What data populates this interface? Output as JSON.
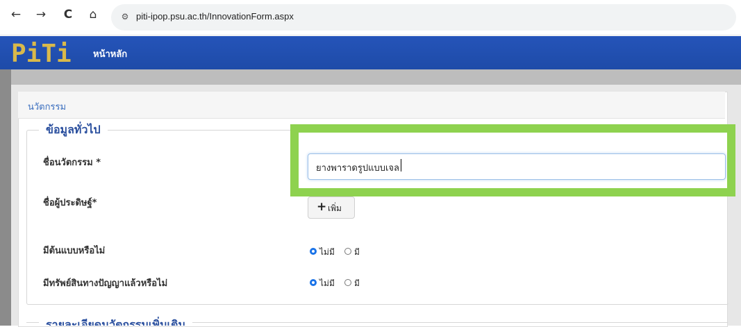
{
  "browser": {
    "back": "←",
    "forward": "→",
    "reload": "C",
    "home": "⌂",
    "site_icon": "⚙",
    "url": "piti-ipop.psu.ac.th/InnovationForm.aspx"
  },
  "header": {
    "logo_text": "PiTi",
    "nav_home": "หน้าหลัก",
    "bg_color": "#2554b9",
    "logo_color": "#d9b94b"
  },
  "panel": {
    "title": "นวัตกรรม"
  },
  "general": {
    "legend": "ข้อมูลทั่วไป",
    "innovation_name_label": "ชื่อนวัตกรรม",
    "inventor_label": "ชื่อผู้ประดิษฐ์",
    "required_mark": "*",
    "innovation_name_value": "ยางพาราดรูปแบบเจล",
    "add_button_label": "เพิ่ม",
    "add_button_icon": "plus-icon",
    "prototype_label": "มีต้นแบบหรือไม่",
    "ip_label": "มีทรัพย์สินทางปัญญาแล้วหรือไม่",
    "option_no": "ไม่มี",
    "option_yes": "มี",
    "prototype_selected": "ไม่มี",
    "ip_selected": "ไม่มี"
  },
  "next_section": {
    "legend": "รายละเอียดนวัตกรรมเพิ่มเติม"
  },
  "highlight_color": "#8ed24f"
}
